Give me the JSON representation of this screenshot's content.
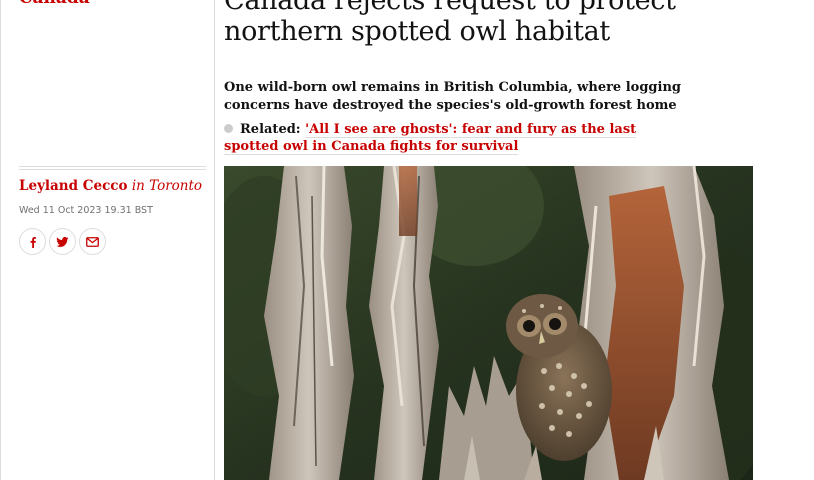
{
  "section": {
    "label": "Canada"
  },
  "article": {
    "headline": "Canada rejects request to protect northern spotted owl habitat",
    "standfirst": "One wild-born owl remains in British Columbia, where logging concerns have destroyed the species's old-growth forest home",
    "related": {
      "label": "Related:",
      "link_text": "'All I see are ghosts': fear and fury as the last spotted owl in Canada fights for survival"
    }
  },
  "meta": {
    "author": "Leyland Cecco",
    "location": "in Toronto",
    "timestamp": "Wed 11 Oct 2023 19.31 BST"
  },
  "share": [
    {
      "icon": "facebook-icon"
    },
    {
      "icon": "twitter-icon"
    },
    {
      "icon": "email-icon"
    }
  ],
  "image": {
    "subject": "northern spotted owl perched in a broken tree snag"
  },
  "colors": {
    "accent": "#c70000",
    "text": "#121212",
    "rule": "#dcdcdc",
    "meta": "#707070"
  }
}
